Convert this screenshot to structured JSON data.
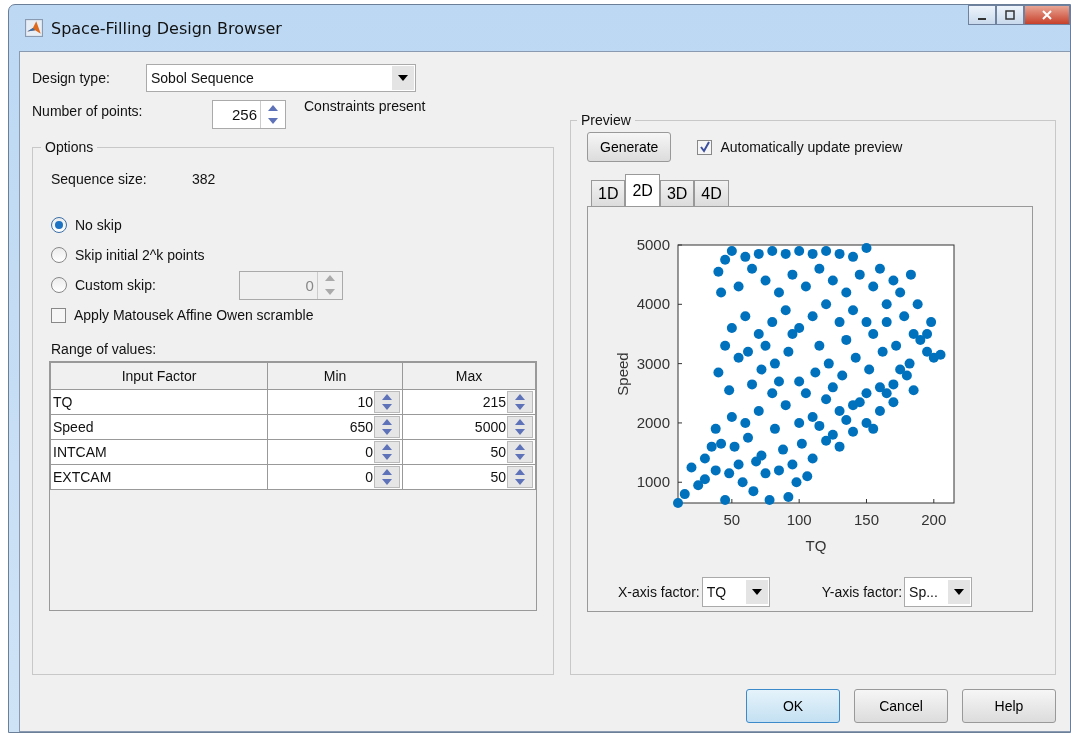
{
  "window": {
    "title": "Space-Filling Design Browser"
  },
  "design_type": {
    "label": "Design type:",
    "value": "Sobol Sequence"
  },
  "number_of_points": {
    "label": "Number of points:",
    "value": "256"
  },
  "constraints_note": "Constraints present",
  "options": {
    "title": "Options",
    "sequence_size_label": "Sequence size:",
    "sequence_size": "382",
    "skip_options": [
      {
        "label": "No skip",
        "selected": true
      },
      {
        "label": "Skip initial 2^k points",
        "selected": false
      },
      {
        "label": "Custom skip:",
        "selected": false
      }
    ],
    "custom_skip": {
      "value": "0",
      "disabled": true
    },
    "scramble": {
      "label": "Apply Matousek Affine Owen scramble",
      "checked": false
    },
    "range_label": "Range of values:",
    "table": {
      "columns": [
        "Input Factor",
        "Min",
        "Max"
      ],
      "rows": [
        {
          "factor": "TQ",
          "min": "10",
          "max": "215"
        },
        {
          "factor": "Speed",
          "min": "650",
          "max": "5000"
        },
        {
          "factor": "INTCAM",
          "min": "0",
          "max": "50"
        },
        {
          "factor": "EXTCAM",
          "min": "0",
          "max": "50"
        }
      ]
    }
  },
  "preview": {
    "title": "Preview",
    "generate_button": "Generate",
    "auto_update": {
      "label": "Automatically update preview",
      "checked": true
    },
    "tabs": [
      {
        "label": "1D",
        "selected": false
      },
      {
        "label": "2D",
        "selected": true
      },
      {
        "label": "3D",
        "selected": false
      },
      {
        "label": "4D",
        "selected": false
      }
    ],
    "chart_data": {
      "type": "scatter",
      "xlabel": "TQ",
      "ylabel": "Speed",
      "xlim": [
        10,
        215
      ],
      "ylim": [
        650,
        5000
      ],
      "xticks": [
        50,
        100,
        150,
        200
      ],
      "yticks": [
        1000,
        2000,
        3000,
        4000,
        5000
      ],
      "x": [
        10,
        15,
        20,
        25,
        30,
        35,
        38,
        42,
        45,
        48,
        52,
        55,
        58,
        62,
        66,
        68,
        72,
        75,
        78,
        82,
        85,
        88,
        92,
        95,
        98,
        102,
        106,
        110,
        115,
        120,
        125,
        130,
        135,
        140,
        145,
        150,
        155,
        160,
        165,
        170,
        175,
        180,
        185,
        190,
        195,
        200,
        205,
        198,
        195,
        188,
        183,
        175,
        170,
        160,
        150,
        140,
        130,
        120,
        110,
        100,
        90,
        80,
        70,
        60,
        50,
        40,
        45,
        55,
        65,
        75,
        85,
        95,
        105,
        115,
        125,
        135,
        145,
        155,
        165,
        178,
        150,
        140,
        130,
        120,
        110,
        100,
        90,
        80,
        70,
        60,
        50,
        42,
        45,
        40,
        48,
        55,
        62,
        72,
        82,
        92,
        100,
        112,
        122,
        132,
        142,
        152,
        162,
        172,
        182,
        170,
        160,
        150,
        140,
        130,
        120,
        110,
        100,
        90,
        80,
        70,
        60,
        50,
        38,
        30,
        65,
        85,
        105,
        125,
        135,
        115,
        95,
        75,
        155,
        165,
        185
      ],
      "series": [
        {
          "color": "#0072bd",
          "values": [
            650,
            800,
            1250,
            950,
            1050,
            1600,
            1200,
            1650,
            700,
            1150,
            1600,
            1300,
            1000,
            1750,
            850,
            1350,
            1450,
            1150,
            700,
            1900,
            1200,
            1550,
            750,
            1300,
            1000,
            1650,
            1100,
            1400,
            1950,
            1700,
            1800,
            1600,
            2050,
            1850,
            2350,
            2000,
            1900,
            2600,
            2500,
            2350,
            2900,
            2800,
            2550,
            3400,
            3200,
            3100,
            3150,
            3700,
            3500,
            4000,
            4500,
            4200,
            4400,
            4600,
            4950,
            4800,
            4850,
            4900,
            4850,
            4900,
            4850,
            4900,
            4850,
            4800,
            4900,
            4550,
            4750,
            4300,
            4600,
            4400,
            4200,
            4500,
            4300,
            4600,
            4400,
            4200,
            4500,
            4300,
            4000,
            3800,
            3700,
            3900,
            3700,
            4000,
            3800,
            3600,
            3900,
            3700,
            3500,
            3800,
            3600,
            4200,
            3300,
            2850,
            2550,
            3100,
            3200,
            2900,
            3000,
            3200,
            2700,
            2850,
            3000,
            2800,
            3100,
            2900,
            3200,
            3300,
            3000,
            2650,
            2200,
            2500,
            2300,
            2200,
            2400,
            2100,
            2000,
            2300,
            2500,
            2200,
            2000,
            2100,
            1900,
            1400,
            2650,
            2700,
            2500,
            2600,
            3400,
            3300,
            3500,
            3300,
            3500,
            3700,
            3500
          ]
        }
      ]
    },
    "x_axis_factor": {
      "label": "X-axis factor:",
      "value": "TQ"
    },
    "y_axis_factor": {
      "label": "Y-axis factor:",
      "value": "Sp..."
    }
  },
  "buttons": [
    {
      "label": "OK",
      "default": true
    },
    {
      "label": "Cancel",
      "default": false
    },
    {
      "label": "Help",
      "default": false
    }
  ]
}
